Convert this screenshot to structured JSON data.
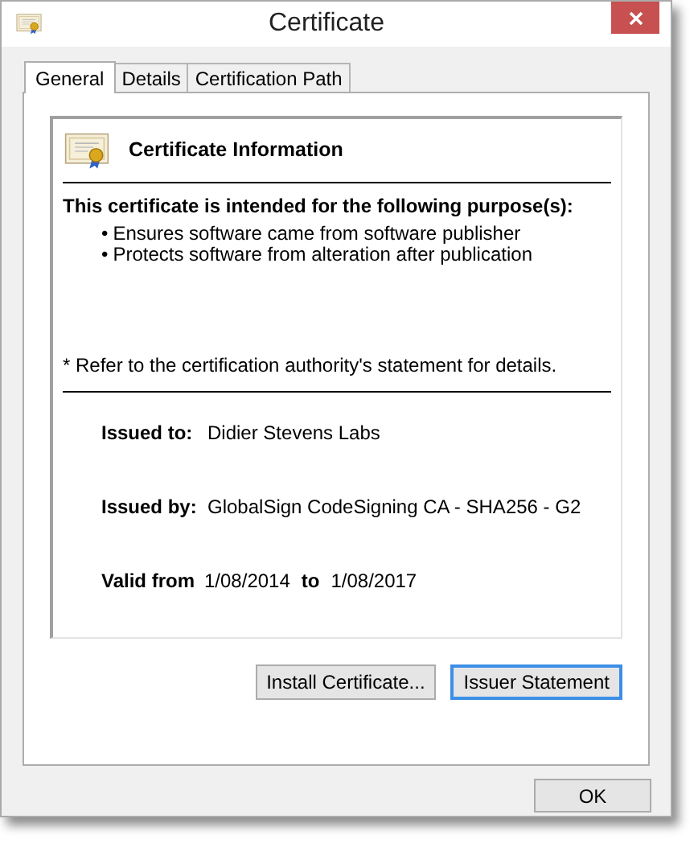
{
  "window": {
    "title": "Certificate"
  },
  "tabs": [
    {
      "label": "General",
      "selected": true
    },
    {
      "label": "Details",
      "selected": false
    },
    {
      "label": "Certification Path",
      "selected": false
    }
  ],
  "info": {
    "heading": "Certificate Information",
    "purpose_heading": "This certificate is intended for the following purpose(s):",
    "purposes": [
      "Ensures software came from software publisher",
      "Protects software from alteration after publication"
    ],
    "bullet": "•",
    "note": "* Refer to the certification authority's statement for details.",
    "issued_to_label": "Issued to:",
    "issued_to": "Didier Stevens Labs",
    "issued_by_label": "Issued by:",
    "issued_by": "GlobalSign CodeSigning CA - SHA256 - G2",
    "valid_from_label": "Valid from",
    "valid_from": "1/08/2014",
    "to_label": "to",
    "valid_to": "1/08/2017"
  },
  "panel_buttons": [
    {
      "label": "Install Certificate...",
      "focused": false
    },
    {
      "label": "Issuer Statement",
      "focused": true
    }
  ],
  "ok_button": {
    "label": "OK"
  }
}
